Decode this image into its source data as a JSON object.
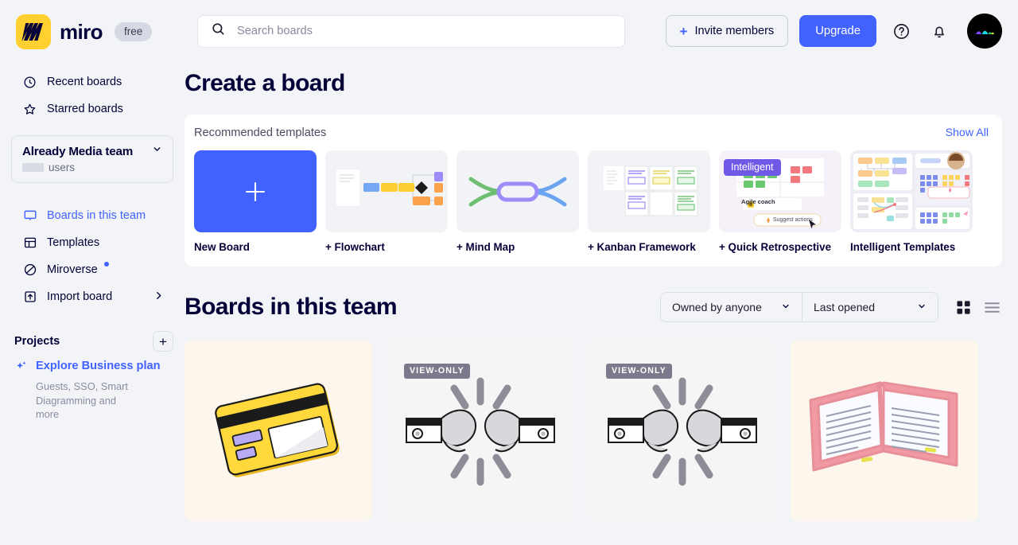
{
  "brand": {
    "name": "miro",
    "plan_badge": "free",
    "accent": "#4262ff",
    "logo_bg": "#ffd02f"
  },
  "sidebar": {
    "nav": [
      {
        "label": "Recent boards",
        "icon": "clock-icon",
        "accent": false
      },
      {
        "label": "Starred boards",
        "icon": "star-icon",
        "accent": false
      }
    ],
    "team": {
      "name": "Already Media team",
      "users_label": "users",
      "users_count_redacted": true,
      "chevron": "chevron-down-icon"
    },
    "nav2": [
      {
        "label": "Boards in this team",
        "icon": "board-icon",
        "accent": true
      },
      {
        "label": "Templates",
        "icon": "templates-icon",
        "accent": false
      },
      {
        "label": "Miroverse",
        "icon": "miroverse-icon",
        "accent": false,
        "dot": true
      },
      {
        "label": "Import board",
        "icon": "import-icon",
        "accent": false,
        "chevron": true
      }
    ],
    "projects": {
      "title": "Projects",
      "add_label": "+"
    },
    "promo": {
      "title": "Explore Business plan",
      "subtitle": "Guests, SSO, Smart Diagramming and more",
      "icon": "sparkle-icon"
    }
  },
  "header": {
    "search_placeholder": "Search boards",
    "search_value": "",
    "search_icon": "search-icon",
    "invite_label": "Invite members",
    "upgrade_label": "Upgrade",
    "help_icon": "help-circle-icon",
    "bell_icon": "bell-icon",
    "avatar_icon": "user-avatar"
  },
  "main": {
    "create_title": "Create a board",
    "templates_panel": {
      "label": "Recommended templates",
      "show_all": "Show All",
      "cards": [
        {
          "label": "New Board",
          "kind": "new"
        },
        {
          "label": "+ Flowchart",
          "kind": "flowchart"
        },
        {
          "label": "+ Mind Map",
          "kind": "mindmap"
        },
        {
          "label": "+ Kanban Framework",
          "kind": "kanban"
        },
        {
          "label": "+ Quick Retrospective",
          "kind": "retro",
          "badge": "Intelligent",
          "inner_labels": {
            "agent": "Agile coach",
            "action": "Suggest actions"
          }
        },
        {
          "label": "Intelligent Templates",
          "kind": "intelligent"
        }
      ]
    },
    "boards_section": {
      "title": "Boards in this team",
      "filter_owner": "Owned by anyone",
      "filter_sort": "Last opened",
      "view_grid_icon": "grid-view-icon",
      "view_list_icon": "list-view-icon",
      "active_view": "grid",
      "cards": [
        {
          "art": "credit-card",
          "badge": null,
          "bg": "#fdf6ec"
        },
        {
          "art": "fist-bump",
          "badge": "VIEW-ONLY",
          "bg": "#f5f5f5"
        },
        {
          "art": "fist-bump",
          "badge": "VIEW-ONLY",
          "bg": "#f5f5f5"
        },
        {
          "art": "open-book",
          "badge": null,
          "bg": "#fdf6ec"
        }
      ]
    }
  }
}
